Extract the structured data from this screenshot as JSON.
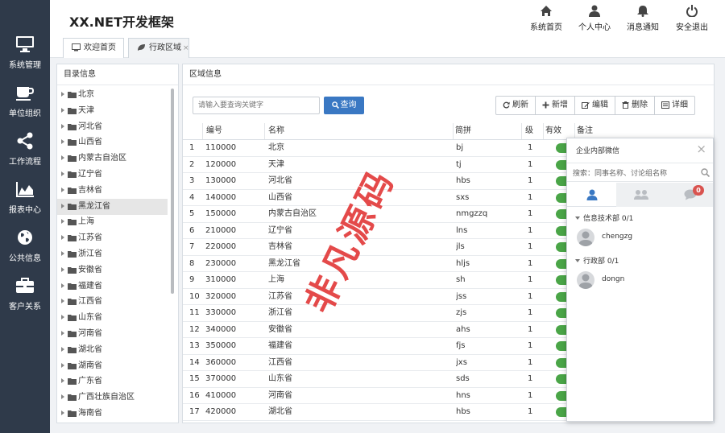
{
  "app_title": "XX.NET开发框架",
  "sidebar": {
    "items": [
      {
        "label": "系统管理",
        "icon": "monitor-icon"
      },
      {
        "label": "单位组织",
        "icon": "coffee-cup-icon"
      },
      {
        "label": "工作流程",
        "icon": "share-icon"
      },
      {
        "label": "报表中心",
        "icon": "area-chart-icon"
      },
      {
        "label": "公共信息",
        "icon": "globe-icon"
      },
      {
        "label": "客户关系",
        "icon": "briefcase-icon"
      }
    ]
  },
  "header": {
    "buttons": [
      {
        "label": "系统首页",
        "icon": "home-icon"
      },
      {
        "label": "个人中心",
        "icon": "user-icon"
      },
      {
        "label": "消息通知",
        "icon": "bell-icon"
      },
      {
        "label": "安全退出",
        "icon": "power-icon"
      }
    ]
  },
  "tabs": [
    {
      "label": "欢迎首页",
      "icon": "monitor-icon"
    },
    {
      "label": "行政区域",
      "icon": "leaf-icon",
      "close": "×"
    }
  ],
  "tree": {
    "title": "目录信息",
    "items": [
      "北京",
      "天津",
      "河北省",
      "山西省",
      "内蒙古自治区",
      "辽宁省",
      "吉林省",
      "黑龙江省",
      "上海",
      "江苏省",
      "浙江省",
      "安徽省",
      "福建省",
      "江西省",
      "山东省",
      "河南省",
      "湖北省",
      "湖南省",
      "广东省",
      "广西壮族自治区",
      "海南省"
    ],
    "selected_index": 7
  },
  "main": {
    "title": "区域信息",
    "search": {
      "placeholder": "请输入要查询关键字",
      "button_label": "查询"
    },
    "toolbar": [
      {
        "label": "刷新",
        "icon": "refresh-icon"
      },
      {
        "label": "新增",
        "icon": "plus-icon"
      },
      {
        "label": "编辑",
        "icon": "edit-icon"
      },
      {
        "label": "删除",
        "icon": "trash-icon"
      },
      {
        "label": "详细",
        "icon": "list-icon"
      }
    ],
    "table": {
      "columns": [
        "编号",
        "名称",
        "简拼",
        "级",
        "有效",
        "备注"
      ],
      "rows": [
        [
          "1",
          "110000",
          "北京",
          "bj",
          "1"
        ],
        [
          "2",
          "120000",
          "天津",
          "tj",
          "1"
        ],
        [
          "3",
          "130000",
          "河北省",
          "hbs",
          "1"
        ],
        [
          "4",
          "140000",
          "山西省",
          "sxs",
          "1"
        ],
        [
          "5",
          "150000",
          "内蒙古自治区",
          "nmgzzq",
          "1"
        ],
        [
          "6",
          "210000",
          "辽宁省",
          "lns",
          "1"
        ],
        [
          "7",
          "220000",
          "吉林省",
          "jls",
          "1"
        ],
        [
          "8",
          "230000",
          "黑龙江省",
          "hljs",
          "1"
        ],
        [
          "9",
          "310000",
          "上海",
          "sh",
          "1"
        ],
        [
          "10",
          "320000",
          "江苏省",
          "jss",
          "1"
        ],
        [
          "11",
          "330000",
          "浙江省",
          "zjs",
          "1"
        ],
        [
          "12",
          "340000",
          "安徽省",
          "ahs",
          "1"
        ],
        [
          "13",
          "350000",
          "福建省",
          "fjs",
          "1"
        ],
        [
          "14",
          "360000",
          "江西省",
          "jxs",
          "1"
        ],
        [
          "15",
          "370000",
          "山东省",
          "sds",
          "1"
        ],
        [
          "16",
          "410000",
          "河南省",
          "hns",
          "1"
        ],
        [
          "17",
          "420000",
          "湖北省",
          "hbs",
          "1"
        ]
      ]
    }
  },
  "chat": {
    "title": "企业内部微信",
    "close": "×",
    "search_placeholder": "搜索：同事名称、讨论组名称",
    "tabs": [
      {
        "icon": "user-icon"
      },
      {
        "icon": "users-icon"
      },
      {
        "icon": "comment-icon",
        "badge": "0"
      }
    ],
    "groups": [
      {
        "label": "信息技术部 0/1",
        "members": [
          "chengzg"
        ]
      },
      {
        "label": "行政部 0/1",
        "members": [
          "dongn"
        ]
      }
    ]
  },
  "watermark": "非凡源码",
  "colors": {
    "sidebar_bg": "#2f3a4a",
    "primary": "#3a78c3",
    "toggle_on": "#4aa547",
    "badge": "#d9534f",
    "watermark": "#e23b3b"
  }
}
